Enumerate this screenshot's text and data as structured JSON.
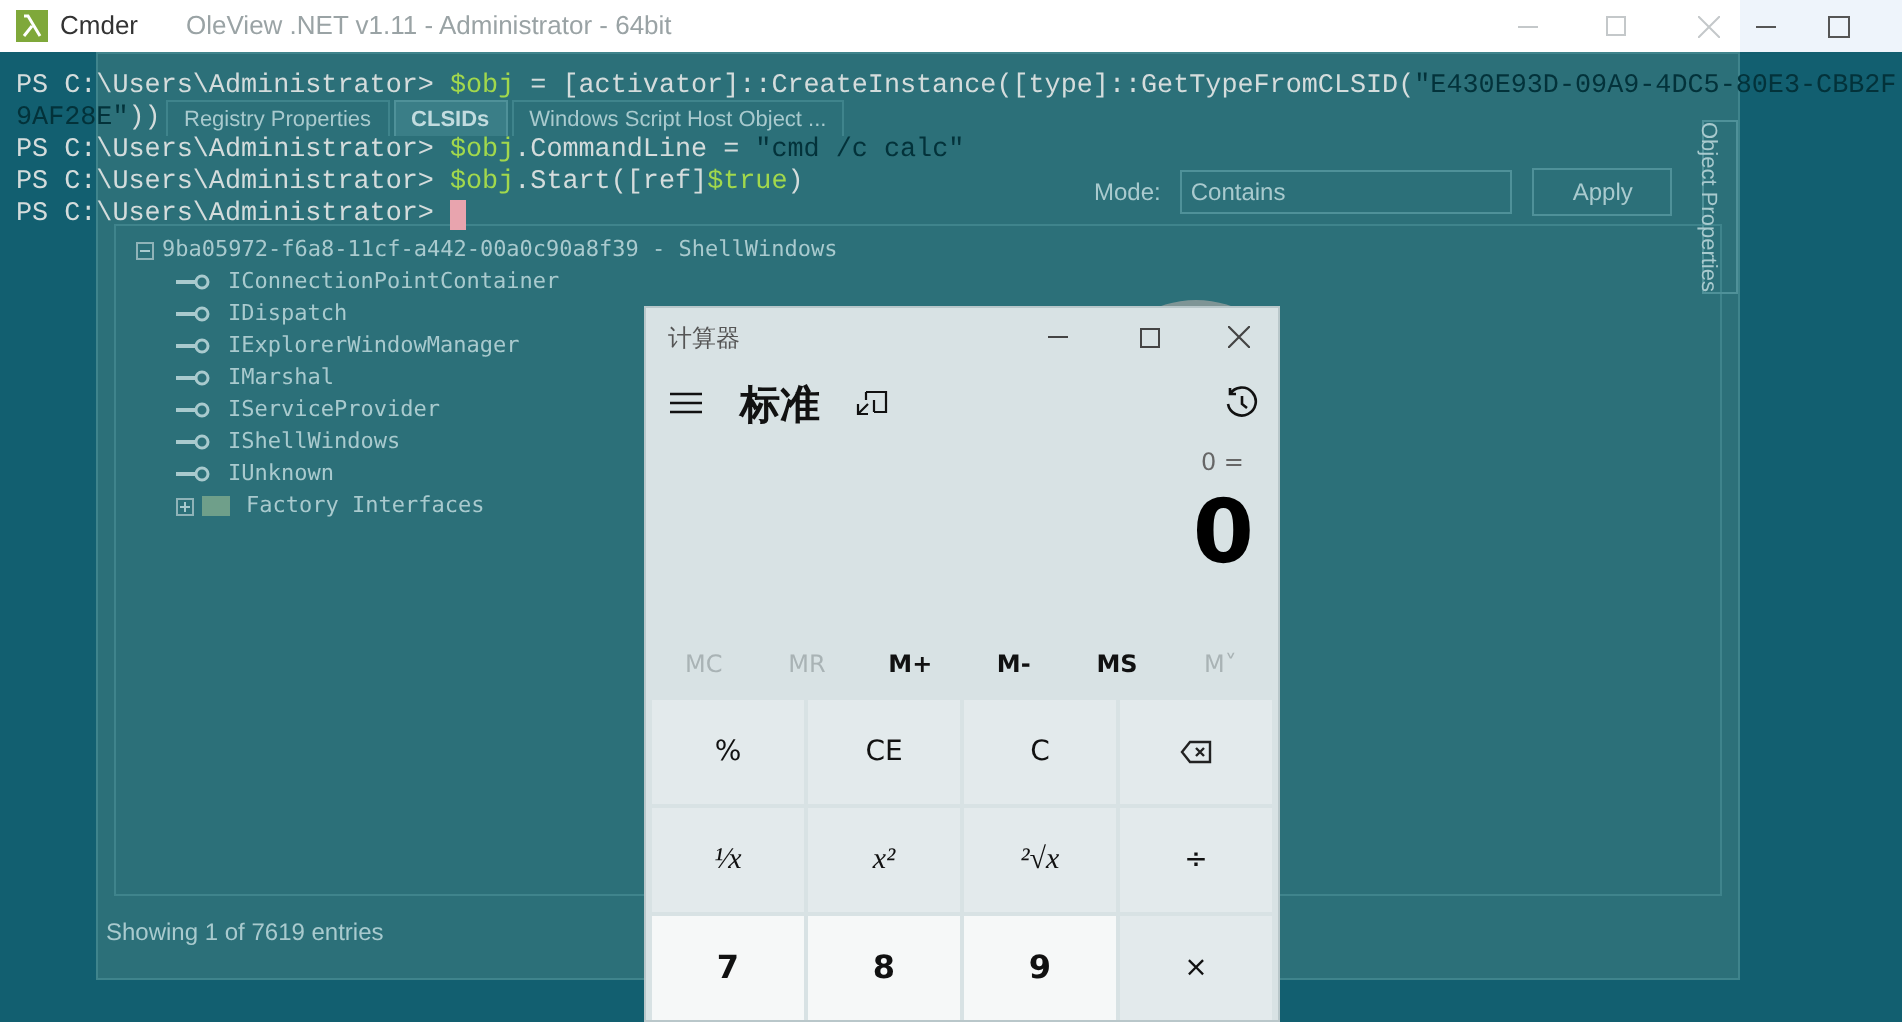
{
  "background_window": {
    "title": "OleView .NET v1.11 - Administrator - 64bit",
    "tabs": [
      {
        "label": "Registry Properties",
        "selected": false
      },
      {
        "label": "CLSIDs",
        "selected": true
      },
      {
        "label": "Windows Script Host Object ...",
        "selected": false
      }
    ],
    "filter": {
      "mode_label": "Mode:",
      "mode_value": "Contains",
      "apply_button": "Apply"
    },
    "tree": {
      "label": "9ba05972-f6a8-11cf-a442-00a0c90a8f39 - ShellWindows",
      "expanded": true,
      "children": [
        {
          "label": "IConnectionPointContainer",
          "kind": "interface"
        },
        {
          "label": "IDispatch",
          "kind": "interface"
        },
        {
          "label": "IExplorerWindowManager",
          "kind": "interface"
        },
        {
          "label": "IMarshal",
          "kind": "interface"
        },
        {
          "label": "IServiceProvider",
          "kind": "interface"
        },
        {
          "label": "IShellWindows",
          "kind": "interface"
        },
        {
          "label": "IUnknown",
          "kind": "interface"
        },
        {
          "label": "Factory Interfaces",
          "kind": "folder",
          "expanded": false
        }
      ]
    },
    "side_panel": "Object Properties",
    "status": "Showing 1 of 7619 entries"
  },
  "terminal": {
    "title": "Cmder",
    "lines": [
      {
        "cursor": false,
        "segments": [
          {
            "text": "PS C:\\Users\\Administrator> ",
            "kind": "prompt"
          },
          {
            "text": "$obj",
            "kind": "variable"
          },
          {
            "text": " = ",
            "kind": "plain"
          },
          {
            "text": "[activator]::CreateInstance([type]::GetTypeFromCLSID(",
            "kind": "plain"
          },
          {
            "text": "\"E430E93D-09A9-4DC5-80E3-CBB2F",
            "kind": "string"
          }
        ]
      },
      {
        "cursor": false,
        "segments": [
          {
            "text": "9AF28E\"",
            "kind": "string"
          },
          {
            "text": "))",
            "kind": "plain"
          }
        ]
      },
      {
        "cursor": false,
        "segments": [
          {
            "text": "PS C:\\Users\\Administrator> ",
            "kind": "prompt"
          },
          {
            "text": "$obj",
            "kind": "variable"
          },
          {
            "text": ".CommandLine = ",
            "kind": "plain"
          },
          {
            "text": "\"cmd /c calc\"",
            "kind": "string"
          }
        ]
      },
      {
        "cursor": false,
        "segments": [
          {
            "text": "PS C:\\Users\\Administrator> ",
            "kind": "prompt"
          },
          {
            "text": "$obj",
            "kind": "variable"
          },
          {
            "text": ".Start([ref]",
            "kind": "plain"
          },
          {
            "text": "$true",
            "kind": "variable"
          },
          {
            "text": ")",
            "kind": "plain"
          }
        ]
      },
      {
        "cursor": true,
        "segments": [
          {
            "text": "PS C:\\Users\\Administrator> ",
            "kind": "prompt"
          }
        ]
      }
    ]
  },
  "calculator": {
    "title": "计算器",
    "mode": "标准",
    "expression": "0 =",
    "display": "0",
    "memory": [
      {
        "label": "MC",
        "disabled": true
      },
      {
        "label": "MR",
        "disabled": true
      },
      {
        "label": "M+",
        "disabled": false
      },
      {
        "label": "M-",
        "disabled": false
      },
      {
        "label": "MS",
        "disabled": false
      },
      {
        "label": "M˅",
        "disabled": true
      }
    ],
    "keys": [
      {
        "label": "%",
        "kind": "op"
      },
      {
        "label": "CE",
        "kind": "op"
      },
      {
        "label": "C",
        "kind": "op"
      },
      {
        "kind": "backspace"
      },
      {
        "label": "¹⁄x",
        "kind": "math"
      },
      {
        "label": "x²",
        "kind": "math"
      },
      {
        "label": "²√x",
        "kind": "math"
      },
      {
        "label": "÷",
        "kind": "op"
      },
      {
        "label": "7",
        "kind": "num"
      },
      {
        "label": "8",
        "kind": "num"
      },
      {
        "label": "9",
        "kind": "num"
      },
      {
        "label": "×",
        "kind": "op"
      }
    ]
  }
}
